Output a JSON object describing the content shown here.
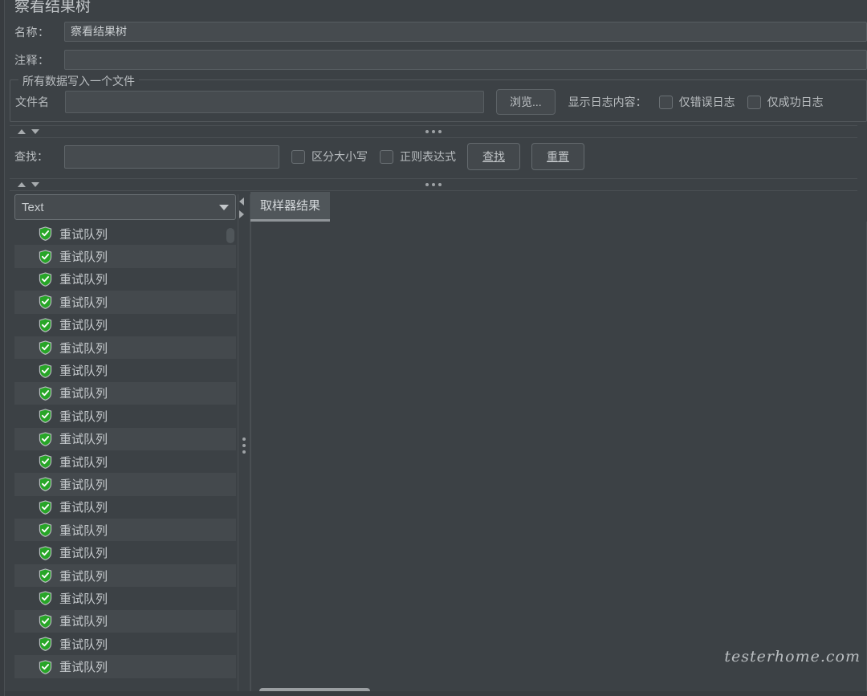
{
  "panel": {
    "title": "察看结果树"
  },
  "fields": {
    "name_label": "名称：",
    "name_value": "察看结果树",
    "comment_label": "注释：",
    "comment_value": ""
  },
  "file_group": {
    "title": "所有数据写入一个文件",
    "filename_label": "文件名",
    "filename_value": "",
    "browse_button": "浏览...",
    "log_content_label": "显示日志内容：",
    "errors_only": "仅错误日志",
    "errors_only_checked": false,
    "success_only": "仅成功日志",
    "success_only_checked": false
  },
  "search": {
    "label": "查找：",
    "value": "",
    "case_sensitive": "区分大小写",
    "case_sensitive_checked": false,
    "regex": "正则表达式",
    "regex_checked": false,
    "search_button": "查找",
    "reset_button": "重置"
  },
  "renderer": {
    "selected": "Text"
  },
  "tabs": [
    {
      "label": "取样器结果",
      "active": true
    }
  ],
  "tree": {
    "item_label": "重试队列",
    "icon": "green-shield-success-icon",
    "count": 20
  },
  "watermark": "testerhome.com",
  "colors": {
    "background": "#3c4145",
    "field_background": "#464b4f",
    "row_alt": "#44494d",
    "text": "#b9bdc0",
    "success_green": "#27a527",
    "tab_active": "#50565a"
  }
}
